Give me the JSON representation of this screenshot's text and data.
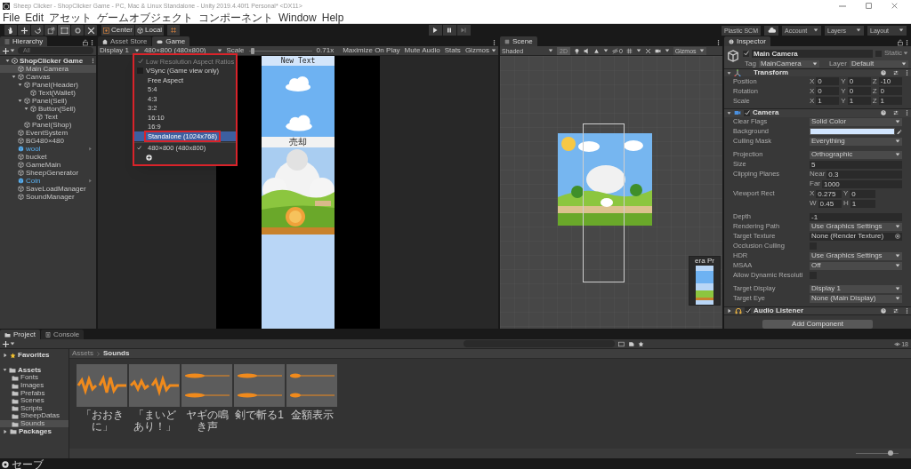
{
  "window": {
    "title": "Sheep Clicker - ShopClicker Game - PC, Mac & Linux Standalone - Unity 2019.4.40f1 Personal* <DX11>"
  },
  "menu": [
    "File",
    "Edit",
    "アセット",
    "ゲームオブジェクト",
    "コンポーネント",
    "Window",
    "Help"
  ],
  "toolbar": {
    "pivot": "Center",
    "space": "Local",
    "right": [
      {
        "label": "Plastic SCM",
        "kind": "scm"
      },
      {
        "kind": "cloud"
      },
      {
        "label": "Account",
        "kind": "dropdown"
      },
      {
        "label": "Layers",
        "kind": "dropdown"
      },
      {
        "label": "Layout",
        "kind": "dropdown"
      }
    ]
  },
  "hierarchy": {
    "tab": "Hierarchy",
    "search_placeholder": "All",
    "items": [
      {
        "label": "ShopClicker Game",
        "kind": "scene",
        "selected": false,
        "expanded": true,
        "children": [
          {
            "label": "Main Camera",
            "kind": "object",
            "selected": true
          },
          {
            "label": "Canvas",
            "kind": "object",
            "selected": false,
            "expanded": true,
            "children": [
              {
                "label": "Panel(Header)",
                "kind": "object",
                "selected": false,
                "expanded": true,
                "children": [
                  {
                    "label": "Text(Wallet)",
                    "kind": "object",
                    "selected": false
                  }
                ]
              },
              {
                "label": "Panel(Sell)",
                "kind": "object",
                "selected": false,
                "expanded": true,
                "children": [
                  {
                    "label": "Button(Sell)",
                    "kind": "object",
                    "selected": false,
                    "expanded": true,
                    "children": [
                      {
                        "label": "Text",
                        "kind": "object",
                        "selected": false
                      }
                    ]
                  }
                ]
              },
              {
                "label": "Panel(Shop)",
                "kind": "object",
                "selected": false
              }
            ]
          },
          {
            "label": "EventSystem",
            "kind": "object",
            "selected": false
          },
          {
            "label": "BG480×480",
            "kind": "object",
            "selected": false
          },
          {
            "label": "wool",
            "kind": "prefab",
            "selected": false
          },
          {
            "label": "bucket",
            "kind": "object",
            "selected": false
          },
          {
            "label": "GameMain",
            "kind": "object",
            "selected": false
          },
          {
            "label": "SheepGenerator",
            "kind": "object",
            "selected": false
          },
          {
            "label": "Coin",
            "kind": "prefab",
            "selected": false
          },
          {
            "label": "SaveLoadManager",
            "kind": "object",
            "selected": false
          },
          {
            "label": "SoundManager",
            "kind": "object",
            "selected": false
          }
        ]
      }
    ]
  },
  "game": {
    "tabs": [
      {
        "label": "Asset Store",
        "kind": "store",
        "selected": false
      },
      {
        "label": "Game",
        "kind": "game",
        "selected": true
      }
    ],
    "display": "Display 1",
    "resolution": "480×800 (480x800)",
    "scale_label": "Scale",
    "scale": "0.71x",
    "scale_slider": {
      "level": 0.02
    },
    "toggles": [
      {
        "label": "Maximize On Play",
        "kind": "toggle"
      },
      {
        "label": "Mute Audio",
        "kind": "toggle"
      },
      {
        "label": "Stats",
        "kind": "toggle"
      },
      {
        "label": "Gizmos",
        "kind": "dropdown"
      }
    ],
    "screen": {
      "header_text": "New Text",
      "button_text": "売却"
    },
    "resolution_menu": {
      "annotated": true,
      "items": [
        {
          "label": "Low Resolution Aspect Ratios",
          "kind": "toggle",
          "checked": true,
          "disabled": true
        },
        {
          "label": "VSync (Game view only)",
          "kind": "toggle",
          "checked": false,
          "disabled": false
        },
        {
          "label": "Free Aspect",
          "kind": "option",
          "checked": false,
          "selected": false,
          "annotated": false
        },
        {
          "label": "5:4",
          "kind": "option",
          "checked": false,
          "selected": false,
          "annotated": false
        },
        {
          "label": "4:3",
          "kind": "option",
          "checked": false,
          "selected": false,
          "annotated": false
        },
        {
          "label": "3:2",
          "kind": "option",
          "checked": false,
          "selected": false,
          "annotated": false
        },
        {
          "label": "16:10",
          "kind": "option",
          "checked": false,
          "selected": false,
          "annotated": false
        },
        {
          "label": "16:9",
          "kind": "option",
          "checked": false,
          "selected": false,
          "annotated": false
        },
        {
          "label": "Standalone (1024x768)",
          "kind": "option",
          "checked": false,
          "selected": true,
          "annotated": true
        },
        {
          "label": "480×800 (480x800)",
          "kind": "option",
          "checked": true,
          "selected": false,
          "annotated": false
        },
        {
          "kind": "add"
        }
      ]
    }
  },
  "scene": {
    "tab": "Scene",
    "shading": "Shaded",
    "mode_2d": "2D",
    "hidden_count": "0",
    "gizmos": "Gizmos",
    "preview_title": "era Pr"
  },
  "inspector": {
    "tab": "Inspector",
    "object": {
      "active": true,
      "name": "Main Camera",
      "static": false,
      "static_label": "Static",
      "tag_label": "Tag",
      "tag": "MainCamera",
      "layer_label": "Layer",
      "layer": "Default"
    },
    "components": [
      {
        "title": "Transform",
        "kind": "transform",
        "expanded": true,
        "rows": [
          {
            "kind": "vector",
            "label": "Position",
            "lines": [
              [
                {
                  "axis": "X",
                  "value": "0"
                },
                {
                  "axis": "Y",
                  "value": "0"
                },
                {
                  "axis": "Z",
                  "value": "-10"
                }
              ]
            ]
          },
          {
            "kind": "vector",
            "label": "Rotation",
            "lines": [
              [
                {
                  "axis": "X",
                  "value": "0"
                },
                {
                  "axis": "Y",
                  "value": "0"
                },
                {
                  "axis": "Z",
                  "value": "0"
                }
              ]
            ]
          },
          {
            "kind": "vector",
            "label": "Scale",
            "lines": [
              [
                {
                  "axis": "X",
                  "value": "1"
                },
                {
                  "axis": "Y",
                  "value": "1"
                },
                {
                  "axis": "Z",
                  "value": "1"
                }
              ]
            ]
          }
        ]
      },
      {
        "title": "Camera",
        "kind": "camera",
        "enabled": true,
        "expanded": true,
        "rows": [
          {
            "kind": "dropdown",
            "label": "Clear Flags",
            "value": "Solid Color"
          },
          {
            "kind": "color",
            "label": "Background",
            "color": "#d2e6ff"
          },
          {
            "kind": "dropdown",
            "label": "Culling Mask",
            "value": "Everything"
          },
          {
            "kind": "dropdown",
            "label": "Projection",
            "value": "Orthographic",
            "gap": true
          },
          {
            "kind": "text",
            "label": "Size",
            "value": "5"
          },
          {
            "kind": "vector",
            "label": "Clipping Planes",
            "lines": [
              [
                {
                  "axis": "Near",
                  "value": "0.3"
                }
              ],
              [
                {
                  "axis": "Far",
                  "value": "1000"
                }
              ]
            ]
          },
          {
            "kind": "vector",
            "label": "Viewport Rect",
            "lines": [
              [
                {
                  "axis": "X",
                  "value": "0.275"
                },
                {
                  "axis": "Y",
                  "value": "0"
                }
              ],
              [
                {
                  "axis": "W",
                  "value": "0.45"
                },
                {
                  "axis": "H",
                  "value": "1"
                }
              ]
            ]
          },
          {
            "kind": "text",
            "label": "Depth",
            "value": "-1",
            "gap": true
          },
          {
            "kind": "dropdown",
            "label": "Rendering Path",
            "value": "Use Graphics Settings"
          },
          {
            "kind": "object",
            "label": "Target Texture",
            "value": "None (Render Texture)"
          },
          {
            "kind": "checkbox",
            "label": "Occlusion Culling",
            "checked": false
          },
          {
            "kind": "dropdown",
            "label": "HDR",
            "value": "Use Graphics Settings"
          },
          {
            "kind": "dropdown",
            "label": "MSAA",
            "value": "Off"
          },
          {
            "kind": "checkbox",
            "label": "Allow Dynamic Resoluti",
            "checked": false
          },
          {
            "kind": "dropdown",
            "label": "Target Display",
            "value": "Display 1",
            "gap": true
          },
          {
            "kind": "dropdown",
            "label": "Target Eye",
            "value": "None (Main Display)"
          }
        ]
      },
      {
        "title": "Audio Listener",
        "kind": "audio",
        "enabled": true,
        "expanded": false
      }
    ],
    "add_button": "Add Component"
  },
  "project": {
    "tabs": [
      {
        "label": "Project",
        "selected": true
      },
      {
        "label": "Console",
        "selected": false
      }
    ],
    "count": "18",
    "tree": [
      {
        "label": "Favorites",
        "kind": "favorites",
        "selected": false,
        "expanded": false
      },
      {
        "label": "Assets",
        "kind": "root",
        "selected": false,
        "expanded": true,
        "children": [
          {
            "label": "Fonts",
            "kind": "folder",
            "selected": false
          },
          {
            "label": "Images",
            "kind": "folder",
            "selected": false
          },
          {
            "label": "Prefabs",
            "kind": "folder",
            "selected": false
          },
          {
            "label": "Scenes",
            "kind": "folder",
            "selected": false
          },
          {
            "label": "Scripts",
            "kind": "folder",
            "selected": false
          },
          {
            "label": "SheepDatas",
            "kind": "folder",
            "selected": false
          },
          {
            "label": "Sounds",
            "kind": "folder",
            "selected": true
          }
        ]
      },
      {
        "label": "Packages",
        "kind": "root",
        "selected": false,
        "expanded": false
      }
    ],
    "breadcrumb": [
      "Assets",
      "Sounds"
    ],
    "assets": [
      {
        "label": "「おおきに」"
      },
      {
        "label": "「まいどあり！」"
      },
      {
        "label": "ヤギの鳴き声"
      },
      {
        "label": "剣で斬る1"
      },
      {
        "label": "金額表示"
      }
    ],
    "zoom_slider": {
      "level": 0.85
    }
  },
  "status": "セーブ"
}
